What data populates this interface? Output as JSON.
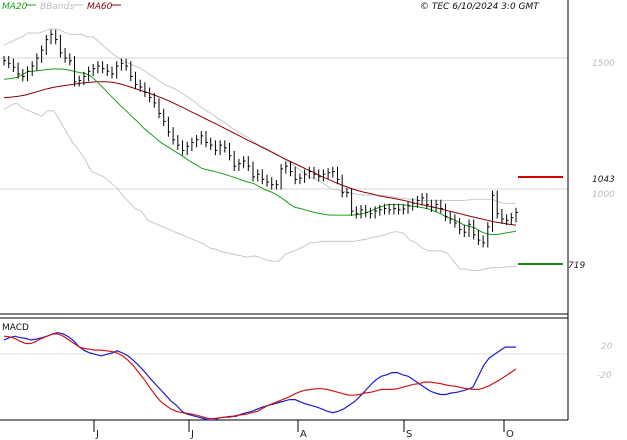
{
  "header": {
    "legend": [
      {
        "label": "MA20",
        "color": "#1aa01a"
      },
      {
        "label": "BBands",
        "color": "#c0c0c0"
      },
      {
        "label": "MA60",
        "color": "#8b0000"
      }
    ],
    "copyright": "© TEC 6/10/2024 3:0 GMT"
  },
  "levels": {
    "resistance": {
      "value": 1043,
      "label": "1043",
      "color": "#cc0000"
    },
    "support": {
      "value": 719,
      "label": "719",
      "color": "#1a8a1a"
    }
  },
  "macd_panel": {
    "label": "MACD"
  },
  "chart_data": [
    {
      "type": "line",
      "name": "price",
      "title": "",
      "x_ticks": [
        "J",
        "J",
        "A",
        "S",
        "O"
      ],
      "y_ticks": [
        1500,
        1000
      ],
      "y_tick_labels": [
        "1500",
        "1000"
      ],
      "ylim": [
        560,
        1750
      ],
      "grid": true,
      "legend": "top-left",
      "n_bars": 100,
      "series": [
        {
          "name": "MA20",
          "color": "#1aa01a",
          "values": [
            1450,
            1452,
            1455,
            1465,
            1478,
            1480,
            1483,
            1485,
            1488,
            1489,
            1488,
            1485,
            1480,
            1475,
            1472,
            1460,
            1440,
            1418,
            1395,
            1373,
            1350,
            1330,
            1308,
            1288,
            1265,
            1246,
            1228,
            1209,
            1196,
            1182,
            1168,
            1154,
            1138,
            1126,
            1112,
            1106,
            1101,
            1095,
            1089,
            1082,
            1075,
            1066,
            1060,
            1054,
            1041,
            1030,
            1022,
            1010,
            995,
            978,
            964,
            960,
            953,
            947,
            942,
            938,
            935,
            935,
            935,
            935,
            935,
            938,
            942,
            950,
            960,
            968,
            975,
            975,
            975,
            973,
            969,
            967,
            963,
            958,
            950,
            940,
            928,
            920,
            910,
            898,
            892,
            885,
            872,
            864,
            860,
            862,
            866,
            870,
            874
          ]
        },
        {
          "name": "BBands",
          "color": "#c8c8c8",
          "values_upper": [
            1580,
            1590,
            1600,
            1610,
            1625,
            1625,
            1625,
            1635,
            1640,
            1640,
            1630,
            1620,
            1620,
            1620,
            1610,
            1610,
            1590,
            1570,
            1550,
            1535,
            1520,
            1510,
            1500,
            1490,
            1475,
            1460,
            1445,
            1430,
            1420,
            1410,
            1395,
            1380,
            1365,
            1345,
            1330,
            1318,
            1300,
            1287,
            1270,
            1255,
            1240,
            1229,
            1212,
            1197,
            1188,
            1176,
            1165,
            1147,
            1133,
            1117,
            1099,
            1084,
            1073,
            1063,
            1050,
            1035,
            1030,
            1025,
            1020,
            1015,
            1012,
            1010,
            1010,
            1010,
            1008,
            1005,
            1000,
            998,
            996,
            993,
            990,
            990,
            990,
            990,
            990,
            990,
            990,
            990,
            992,
            995,
            995,
            995,
            995,
            985,
            980,
            980,
            978
          ],
          "values_lower": [
            1335,
            1350,
            1360,
            1340,
            1330,
            1320,
            1310,
            1330,
            1330,
            1290,
            1250,
            1210,
            1180,
            1145,
            1100,
            1090,
            1080,
            1060,
            1040,
            1010,
            985,
            960,
            950,
            915,
            905,
            895,
            885,
            875,
            865,
            855,
            845,
            835,
            825,
            810,
            805,
            795,
            790,
            785,
            780,
            775,
            780,
            775,
            765,
            760,
            760,
            785,
            795,
            805,
            815,
            830,
            832,
            835,
            835,
            835,
            835,
            835,
            835,
            840,
            843,
            850,
            855,
            860,
            870,
            872,
            865,
            840,
            830,
            810,
            800,
            800,
            800,
            790,
            760,
            730,
            730,
            725,
            725,
            730,
            735,
            735,
            737,
            740,
            740
          ]
        },
        {
          "name": "MA60",
          "color": "#8b0000",
          "values": [
            1380,
            1382,
            1385,
            1390,
            1398,
            1406,
            1414,
            1420,
            1424,
            1428,
            1432,
            1436,
            1438,
            1440,
            1440,
            1438,
            1433,
            1425,
            1416,
            1407,
            1398,
            1388,
            1378,
            1366,
            1353,
            1340,
            1326,
            1313,
            1299,
            1286,
            1272,
            1258,
            1244,
            1230,
            1216,
            1203,
            1189,
            1175,
            1161,
            1147,
            1134,
            1121,
            1108,
            1096,
            1082,
            1070,
            1058,
            1047,
            1037,
            1028,
            1021,
            1015,
            1008,
            1003,
            998,
            993,
            987,
            980,
            974,
            968,
            962,
            955,
            948,
            942,
            935,
            928,
            922,
            915,
            909,
            905,
            900,
            897
          ]
        },
        {
          "name": "close",
          "color": "#000000",
          "values": [
            1520,
            1510,
            1495,
            1470,
            1460,
            1480,
            1500,
            1530,
            1560,
            1600,
            1620,
            1600,
            1550,
            1530,
            1520,
            1440,
            1445,
            1460,
            1480,
            1490,
            1500,
            1490,
            1480,
            1470,
            1500,
            1510,
            1500,
            1460,
            1430,
            1420,
            1400,
            1380,
            1360,
            1320,
            1290,
            1250,
            1220,
            1200,
            1180,
            1195,
            1210,
            1220,
            1235,
            1210,
            1200,
            1180,
            1200,
            1190,
            1160,
            1120,
            1130,
            1140,
            1120,
            1080,
            1090,
            1070,
            1060,
            1050,
            1050,
            1110,
            1120,
            1100,
            1070,
            1075,
            1090,
            1100,
            1090,
            1080,
            1090,
            1095,
            1100,
            1070,
            1020,
            1020,
            950,
            940,
            955,
            945,
            940,
            950,
            955,
            960,
            955,
            960,
            955,
            958,
            970,
            980,
            990,
            1000,
            975,
            965,
            975,
            960,
            930,
            920,
            905,
            880,
            870,
            900,
            860,
            840,
            830,
            890,
            1010,
            940,
            920,
            915,
            925,
            945
          ]
        }
      ]
    },
    {
      "type": "line",
      "name": "MACD",
      "title": "MACD",
      "y_ticks": [
        20,
        -20
      ],
      "y_tick_labels": [
        "20",
        "-20"
      ],
      "ylim": [
        -70,
        70
      ],
      "series": [
        {
          "name": "MACD",
          "color": "#1c1ccc",
          "values": [
            40,
            43,
            45,
            43,
            42,
            40,
            41,
            43,
            45,
            48,
            50,
            48,
            44,
            38,
            30,
            25,
            22,
            20,
            18,
            20,
            22,
            25,
            22,
            18,
            12,
            5,
            -3,
            -12,
            -20,
            -28,
            -36,
            -44,
            -50,
            -58,
            -62,
            -64,
            -66,
            -68,
            -70,
            -70,
            -67,
            -66,
            -65,
            -65,
            -62,
            -60,
            -58,
            -55,
            -52,
            -50,
            -48,
            -46,
            -44,
            -42,
            -42,
            -45,
            -48,
            -50,
            -52,
            -55,
            -58,
            -60,
            -58,
            -55,
            -50,
            -45,
            -38,
            -30,
            -22,
            -15,
            -10,
            -8,
            -5,
            -5,
            -8,
            -10,
            -15,
            -20,
            -25,
            -30,
            -33,
            -35,
            -35,
            -33,
            -32,
            -30,
            -28,
            -25,
            -10,
            5,
            15,
            20,
            25,
            30,
            30,
            30
          ]
        },
        {
          "name": "Signal",
          "color": "#cc1a1a",
          "values": [
            45,
            44,
            42,
            38,
            35,
            35,
            38,
            42,
            45,
            48,
            48,
            45,
            40,
            35,
            30,
            28,
            27,
            26,
            26,
            25,
            24,
            22,
            18,
            12,
            5,
            -5,
            -14,
            -25,
            -35,
            -44,
            -50,
            -55,
            -58,
            -60,
            -61,
            -62,
            -64,
            -66,
            -68,
            -68,
            -67,
            -66,
            -66,
            -64,
            -63,
            -62,
            -60,
            -58,
            -54,
            -50,
            -47,
            -44,
            -41,
            -38,
            -34,
            -31,
            -29,
            -28,
            -27,
            -27,
            -28,
            -30,
            -32,
            -34,
            -36,
            -36,
            -35,
            -33,
            -32,
            -30,
            -28,
            -28,
            -28,
            -27,
            -25,
            -23,
            -21,
            -20,
            -18,
            -18,
            -19,
            -20,
            -22,
            -23,
            -24,
            -26,
            -27,
            -28,
            -28,
            -26,
            -23,
            -19,
            -15,
            -10,
            -5,
            0
          ]
        }
      ]
    }
  ]
}
